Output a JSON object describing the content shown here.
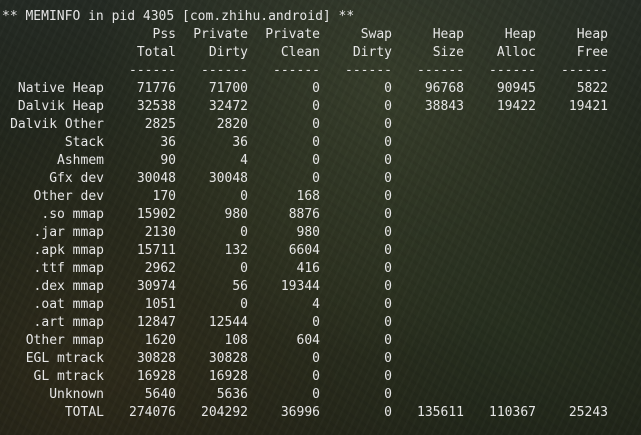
{
  "title": "** MEMINFO in pid 4305 [com.zhihu.android] **",
  "header_row1": [
    "",
    "Pss",
    "Private",
    "Private",
    "Swap",
    "Heap",
    "Heap",
    "Heap"
  ],
  "header_row2": [
    "",
    "Total",
    "Dirty",
    "Clean",
    "Dirty",
    "Size",
    "Alloc",
    "Free"
  ],
  "separator": [
    "",
    "------",
    "------",
    "------",
    "------",
    "------",
    "------",
    "------"
  ],
  "rows": [
    [
      "Native Heap",
      "71776",
      "71700",
      "0",
      "0",
      "96768",
      "90945",
      "5822"
    ],
    [
      "Dalvik Heap",
      "32538",
      "32472",
      "0",
      "0",
      "38843",
      "19422",
      "19421"
    ],
    [
      "Dalvik Other",
      "2825",
      "2820",
      "0",
      "0",
      "",
      "",
      ""
    ],
    [
      "Stack",
      "36",
      "36",
      "0",
      "0",
      "",
      "",
      ""
    ],
    [
      "Ashmem",
      "90",
      "4",
      "0",
      "0",
      "",
      "",
      ""
    ],
    [
      "Gfx dev",
      "30048",
      "30048",
      "0",
      "0",
      "",
      "",
      ""
    ],
    [
      "Other dev",
      "170",
      "0",
      "168",
      "0",
      "",
      "",
      ""
    ],
    [
      ".so mmap",
      "15902",
      "980",
      "8876",
      "0",
      "",
      "",
      ""
    ],
    [
      ".jar mmap",
      "2130",
      "0",
      "980",
      "0",
      "",
      "",
      ""
    ],
    [
      ".apk mmap",
      "15711",
      "132",
      "6604",
      "0",
      "",
      "",
      ""
    ],
    [
      ".ttf mmap",
      "2962",
      "0",
      "416",
      "0",
      "",
      "",
      ""
    ],
    [
      ".dex mmap",
      "30974",
      "56",
      "19344",
      "0",
      "",
      "",
      ""
    ],
    [
      ".oat mmap",
      "1051",
      "0",
      "4",
      "0",
      "",
      "",
      ""
    ],
    [
      ".art mmap",
      "12847",
      "12544",
      "0",
      "0",
      "",
      "",
      ""
    ],
    [
      "Other mmap",
      "1620",
      "108",
      "604",
      "0",
      "",
      "",
      ""
    ],
    [
      "EGL mtrack",
      "30828",
      "30828",
      "0",
      "0",
      "",
      "",
      ""
    ],
    [
      "GL mtrack",
      "16928",
      "16928",
      "0",
      "0",
      "",
      "",
      ""
    ],
    [
      "Unknown",
      "5640",
      "5636",
      "0",
      "0",
      "",
      "",
      ""
    ],
    [
      "TOTAL",
      "274076",
      "204292",
      "36996",
      "0",
      "135611",
      "110367",
      "25243"
    ]
  ]
}
